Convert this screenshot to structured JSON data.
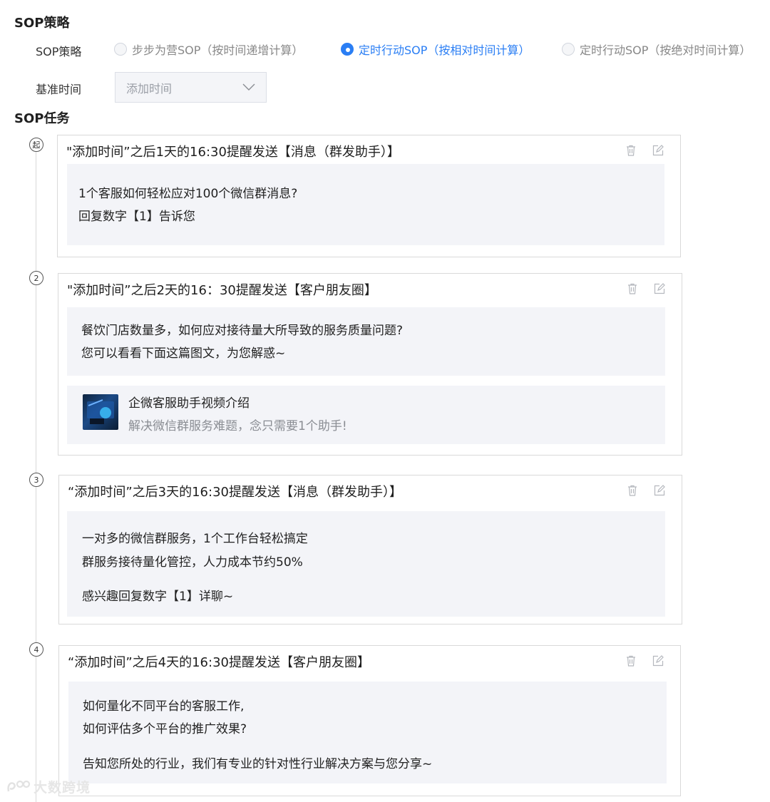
{
  "sections": {
    "strategy_title": "SOP策略",
    "tasks_title": "SOP任务"
  },
  "strategy": {
    "label": "SOP策略",
    "options": [
      {
        "label": "步步为营SOP（按时间递增计算）",
        "selected": false
      },
      {
        "label": "定时行动SOP（按相对时间计算）",
        "selected": true
      },
      {
        "label": "定时行动SOP（按绝对时间计算）",
        "selected": false
      }
    ]
  },
  "base_time": {
    "label": "基准时间",
    "value": "添加时间"
  },
  "tasks": [
    {
      "step": "起",
      "title": "\"添加时间”之后1天的16:30提醒发送【消息（群发助手）】",
      "lines": [
        "1个客服如何轻松应对100个微信群消息?",
        "回复数字【1】告诉您"
      ]
    },
    {
      "step": "2",
      "title": "\"添加时间”之后2天的16：30提醒发送【客户朋友圈】",
      "lines": [
        "餐饮门店数量多，如何应对接待量大所导致的服务质量问题?",
        "您可以看看下面这篇图文，为您解惑~"
      ],
      "link": {
        "title": "企微客服助手视频介绍",
        "desc": "解决微信群服务难题，念只需要1个助手!"
      }
    },
    {
      "step": "3",
      "title": "“添加时间”之后3天的16:30提醒发送【消息（群发助手）】",
      "lines": [
        "一对多的微信群服务，1个工作台轻松搞定",
        "群服务接待量化管控，人力成本节约50%",
        "感兴趣回复数字【1】详聊~"
      ]
    },
    {
      "step": "4",
      "title": "“添加时间”之后4天的16:30提醒发送【客户朋友圈】",
      "lines": [
        "如何量化不同平台的客服工作,",
        "如何评估多个平台的推广效果?",
        "告知您所处的行业，我们有专业的针对性行业解决方案与您分享~"
      ]
    }
  ],
  "icons": {
    "delete": "trash-icon",
    "edit": "edit-icon"
  },
  "watermark": "大数跨境",
  "colors": {
    "accent": "#2a7ef4",
    "msg_bg": "#f3f4f8",
    "border": "#d9d9d9"
  }
}
